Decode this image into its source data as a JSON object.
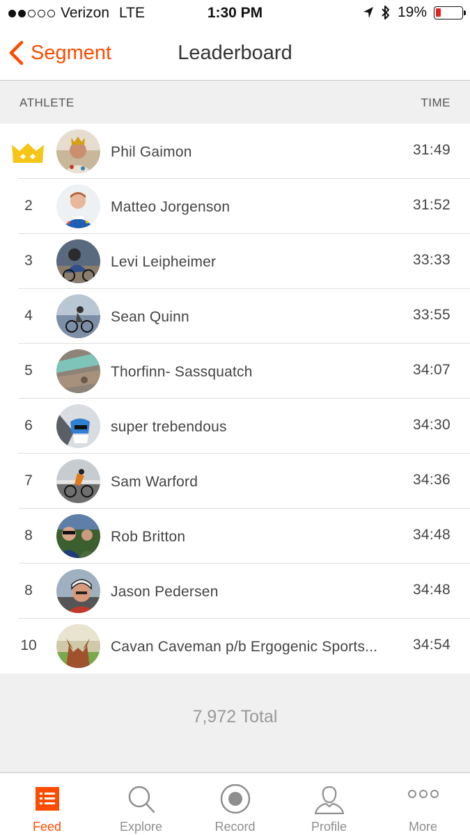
{
  "status_bar": {
    "carrier": "Verizon",
    "network": "LTE",
    "time": "1:30 PM",
    "battery": "19%",
    "battery_level": 0.19,
    "signal_bars_filled": 2,
    "signal_bars_total": 5
  },
  "nav": {
    "back_label": "Segment",
    "title": "Leaderboard"
  },
  "table_header": {
    "athlete": "ATHLETE",
    "time": "TIME"
  },
  "rows": [
    {
      "rank": "",
      "crown": true,
      "name": "Phil Gaimon",
      "time": "31:49",
      "avatar": "avatar-phil"
    },
    {
      "rank": "2",
      "crown": false,
      "name": "Matteo Jorgenson",
      "time": "31:52",
      "avatar": "avatar-matteo"
    },
    {
      "rank": "3",
      "crown": false,
      "name": "Levi Leipheimer",
      "time": "33:33",
      "avatar": "avatar-levi"
    },
    {
      "rank": "4",
      "crown": false,
      "name": "Sean Quinn",
      "time": "33:55",
      "avatar": "avatar-sean"
    },
    {
      "rank": "5",
      "crown": false,
      "name": "Thorfinn- Sassquatch",
      "time": "34:07",
      "avatar": "avatar-thorfinn"
    },
    {
      "rank": "6",
      "crown": false,
      "name": "super trebendous",
      "time": "34:30",
      "avatar": "avatar-super"
    },
    {
      "rank": "7",
      "crown": false,
      "name": "Sam Warford",
      "time": "34:36",
      "avatar": "avatar-sam"
    },
    {
      "rank": "8",
      "crown": false,
      "name": "Rob Britton",
      "time": "34:48",
      "avatar": "avatar-rob"
    },
    {
      "rank": "8",
      "crown": false,
      "name": "Jason Pedersen",
      "time": "34:48",
      "avatar": "avatar-jason"
    },
    {
      "rank": "10",
      "crown": false,
      "name": "Cavan Caveman p/b Ergogenic Sports...",
      "time": "34:54",
      "avatar": "avatar-cavan"
    }
  ],
  "total": "7,972 Total",
  "tabs": [
    {
      "label": "Feed",
      "icon": "feed-icon",
      "active": true
    },
    {
      "label": "Explore",
      "icon": "search-icon",
      "active": false
    },
    {
      "label": "Record",
      "icon": "record-icon",
      "active": false
    },
    {
      "label": "Profile",
      "icon": "profile-icon",
      "active": false
    },
    {
      "label": "More",
      "icon": "more-icon",
      "active": false
    }
  ],
  "colors": {
    "accent": "#fc4c02",
    "crown": "#f5c518",
    "battery_low": "#e5211a"
  }
}
